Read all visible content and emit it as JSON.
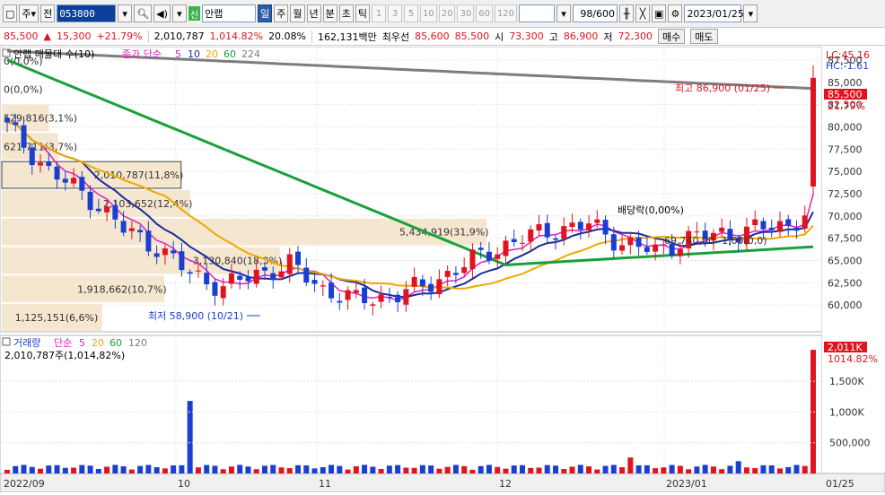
{
  "toolbar": {
    "type_select": "주",
    "jeon_label": "전",
    "stock_code": "053800",
    "stock_name": "안랩",
    "sin_badge": "신",
    "period_tabs": [
      "일",
      "주",
      "월",
      "년",
      "분",
      "초",
      "틱"
    ],
    "interval_buttons": [
      "1",
      "3",
      "5",
      "10",
      "20",
      "30",
      "60",
      "120"
    ],
    "count_display": "98/600",
    "date": "2023/01/25"
  },
  "price_bar": {
    "price": "85,500",
    "change": "15,300",
    "change_pct": "+21.79%",
    "volume": "2,010,787",
    "volume_pct": "1,014.82%",
    "turnover": "20.08%",
    "amount": "162,131백만",
    "best_offer_label": "최우선",
    "best_offer_ask": "85,600",
    "best_offer_bid": "85,500",
    "open_label": "시",
    "open": "73,300",
    "high_label": "고",
    "high": "86,900",
    "low_label": "저",
    "low": "72,300",
    "buy_label": "매수",
    "sell_label": "매도"
  },
  "price_chart": {
    "legend_name": "안랩 매물대 수(10)",
    "legend_ma_label": "종가 단순",
    "legend_ma_periods": [
      "5",
      "10",
      "20",
      "60",
      "224"
    ],
    "lc_label": "LC:45.16",
    "hc_label": "HC:-1.61",
    "current_price_tag": "85,500",
    "current_pct_tag": "21.79%",
    "y_ticks": [
      "87,500",
      "85,000",
      "82,500",
      "80,000",
      "77,500",
      "75,000",
      "72,500",
      "70,000",
      "67,500",
      "65,000",
      "62,500",
      "60,000"
    ],
    "ylim": [
      57000,
      89000
    ],
    "high_annotation": "최고 86,900 (01/25)",
    "low_annotation": "최저 58,900 (10/21)",
    "dividend_annotation": "배당락(0,00%)",
    "volume_profile": [
      {
        "label": "0(0,0%)",
        "pct": 0
      },
      {
        "label": "0(0,0%)",
        "pct": 0
      },
      {
        "label": "529,816(3,1%)",
        "pct": 3.1
      },
      {
        "label": "621,711(3,7%)",
        "pct": 3.7
      },
      {
        "label": "2,010,787(11,8%)",
        "pct": 11.8
      },
      {
        "label": "2,103,652(12,4%)",
        "pct": 12.4
      },
      {
        "label": "5,434,919(31,9%)",
        "pct": 31.9
      },
      {
        "label": "3,130,840(18,3%)",
        "pct": 18.3
      },
      {
        "label": "1,918,662(10,7%)",
        "pct": 10.7
      },
      {
        "label": "1,125,151(6,6%)",
        "pct": 6.6
      }
    ],
    "mid_annotations": [
      "69,740,00",
      "-1,00(0,0)"
    ]
  },
  "volume_chart": {
    "legend_name": "거래량",
    "legend_ma_label": "단순",
    "legend_ma_periods": [
      "5",
      "20",
      "60",
      "120"
    ],
    "volume_text": "2,010,787주(1,014,82%)",
    "current_tag": "2,011K",
    "current_pct_tag": "1014.82%",
    "y_ticks": [
      "1,500K",
      "1,000K",
      "500,000"
    ]
  },
  "x_axis": {
    "labels": [
      "2022/09",
      "10",
      "11",
      "12",
      "2023/01",
      "01/25"
    ]
  },
  "colors": {
    "up": "#e0141e",
    "down": "#1a3fd0",
    "ma5": "#e020c0",
    "ma10": "#1a2d9a",
    "ma20": "#f0a800",
    "ma60": "#1aa03a",
    "ma224": "#7d7d7d",
    "profile": "#f5e6d0"
  }
}
